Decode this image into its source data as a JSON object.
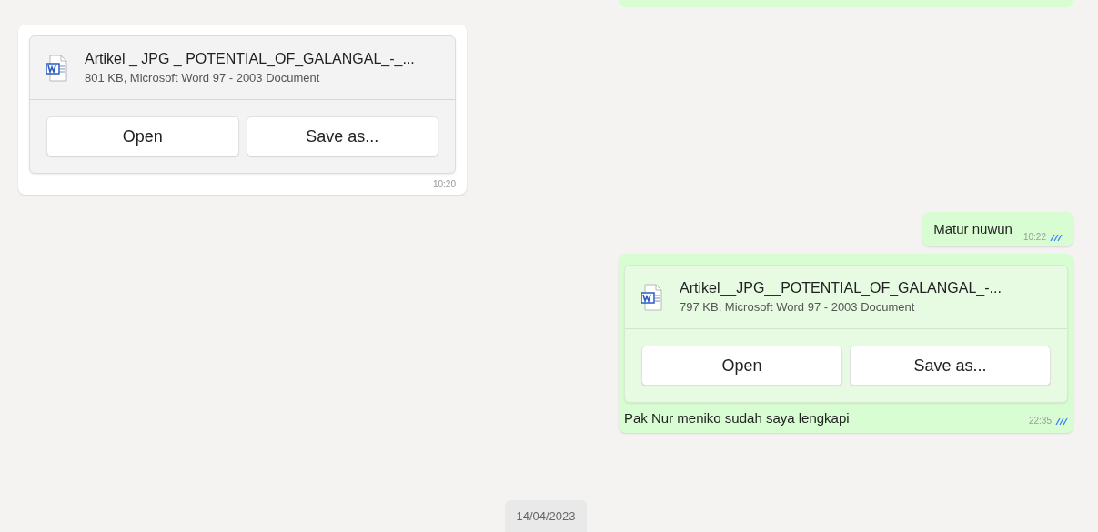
{
  "messages": [
    {
      "kind": "document",
      "outgoing": false,
      "file_name": "Artikel _ JPG _ POTENTIAL_OF_GALANGAL_-_...",
      "file_info": "801 KB, Microsoft Word 97 - 2003 Document",
      "buttons": [
        "Open",
        "Save as..."
      ],
      "time": "10:20"
    },
    {
      "kind": "text",
      "outgoing": true,
      "text": "Matur nuwun",
      "time": "10:22",
      "read": true
    },
    {
      "kind": "document",
      "outgoing": true,
      "file_name": "Artikel__JPG__POTENTIAL_OF_GALANGAL_-...",
      "file_info": "797 KB, Microsoft Word 97 - 2003 Document",
      "buttons": [
        "Open",
        "Save as..."
      ],
      "caption": "Pak Nur meniko sudah saya lengkapi",
      "time": "22:35",
      "read": true
    }
  ],
  "date_chip": "14/04/2023"
}
